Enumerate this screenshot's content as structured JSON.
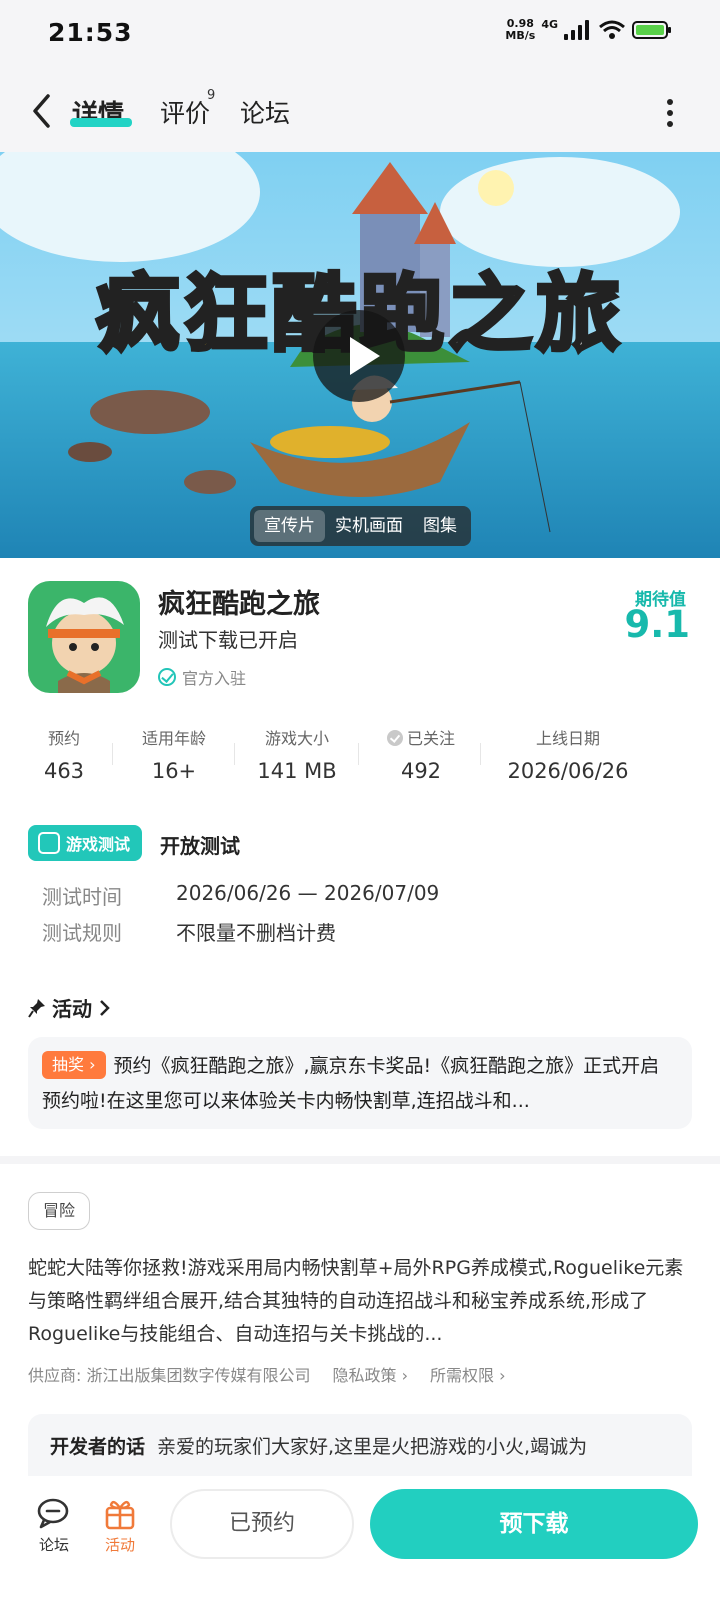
{
  "status_bar": {
    "time": "21:53",
    "speed_value": "0.98",
    "speed_unit": "MB/s",
    "network": "4G"
  },
  "nav": {
    "tabs": [
      "详情",
      "评价",
      "论坛"
    ],
    "review_count": "9"
  },
  "banner": {
    "title_part1": "疯狂",
    "title_part2": "酷跑之旅",
    "media_tabs": [
      "宣传片",
      "实机画面",
      "图集"
    ]
  },
  "game": {
    "name": "疯狂酷跑之旅",
    "status": "测试下载已开启",
    "official_label": "官方入驻",
    "score_label": "期待值",
    "score": "9.1"
  },
  "stats": [
    {
      "label": "预约",
      "value": "463"
    },
    {
      "label": "适用年龄",
      "value": "16+"
    },
    {
      "label": "游戏大小",
      "value": "141 MB"
    },
    {
      "label": "已关注",
      "value": "492"
    },
    {
      "label": "上线日期",
      "value": "2026/06/26"
    }
  ],
  "test": {
    "badge": "游戏测试",
    "title": "开放测试",
    "time_label": "测试时间",
    "time_value": "2026/06/26 — 2026/07/09",
    "rule_label": "测试规则",
    "rule_value": "不限量不删档计费"
  },
  "activity": {
    "heading": "活动",
    "tag": "抽奖",
    "text": "预约《疯狂酷跑之旅》,赢京东卡奖品!《疯狂酷跑之旅》正式开启预约啦!在这里您可以来体验关卡内畅快割草,连招战斗和..."
  },
  "genre": "冒险",
  "description": "蛇蛇大陆等你拯救!游戏采用局内畅快割草+局外RPG养成模式,Roguelike元素与策略性羁绊组合展开,结合其独特的自动连招战斗和秘宝养成系统,形成了Roguelike与技能组合、自动连招与关卡挑战的...",
  "meta": {
    "supplier": "供应商: 浙江出版集团数字传媒有限公司",
    "privacy": "隐私政策",
    "permissions": "所需权限"
  },
  "developer": {
    "label": "开发者的话",
    "text": "亲爱的玩家们大家好,这里是火把游戏的小火,竭诚为"
  },
  "bottom_bar": {
    "forum": "论坛",
    "activity": "活动",
    "reserved": "已预约",
    "predownload": "预下载"
  },
  "colors": {
    "accent": "#22cfc0",
    "score": "#18b9ac",
    "lottery": "#ff7a3d",
    "activity_icon": "#f07a3a"
  }
}
